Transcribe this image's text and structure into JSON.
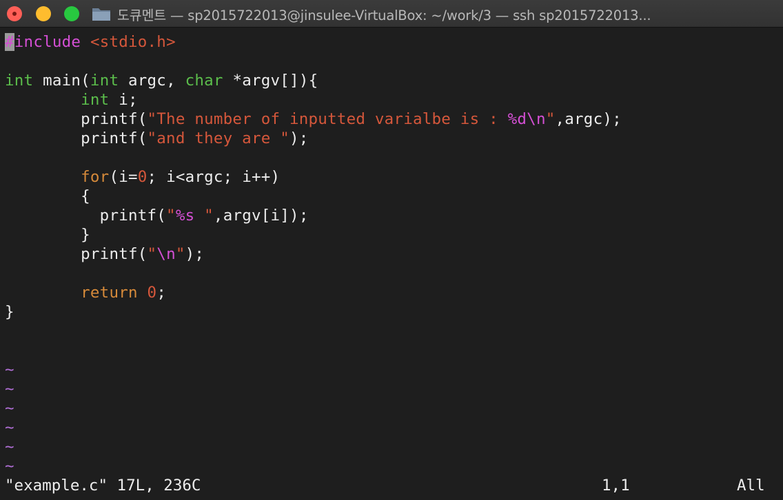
{
  "window": {
    "title": "도큐멘트 — sp2015722013@jinsulee-VirtualBox: ~/work/3 — ssh sp2015722013...",
    "traffic_lights": {
      "close": "#ff5f57",
      "minimize": "#febc2e",
      "maximize": "#28c840"
    },
    "icon": "folder-icon"
  },
  "editor": {
    "colors": {
      "background": "#1e1e1e",
      "foreground": "#ececec",
      "preprocessor": "#d44fd4",
      "string": "#d5573b",
      "type": "#5bbd4b",
      "keyword": "#d68a3a",
      "tilde": "#b16fd6"
    },
    "code": {
      "l1": {
        "hash": "#",
        "directive": "include",
        "header": "<stdio.h>"
      },
      "l3": {
        "t1": "int",
        "a": " main(",
        "t2": "int",
        "b": " argc, ",
        "t3": "char",
        "c": " *argv[]){"
      },
      "l4": {
        "t": "int",
        "a": " i;"
      },
      "l5": {
        "a": "printf(",
        "s": "\"The number of inputted varialbe is : ",
        "f": "%d\\n",
        "q": "\"",
        "b": ",argc);"
      },
      "l6": {
        "a": "printf(",
        "s": "\"and they are \"",
        "b": ");"
      },
      "l8": {
        "k": "for",
        "a": "(i=",
        "n": "0",
        "b": "; i<argc; i++)"
      },
      "l9": {
        "a": "{"
      },
      "l10": {
        "a": "printf(",
        "q1": "\"",
        "f": "%s",
        "q2": " \"",
        "b": ",argv[i]);"
      },
      "l11": {
        "a": "}"
      },
      "l12": {
        "a": "printf(",
        "q1": "\"",
        "f": "\\n",
        "q2": "\"",
        "b": ");"
      },
      "l14": {
        "k": "return",
        "sp": " ",
        "n": "0",
        "b": ";"
      },
      "l15": {
        "a": "}"
      }
    },
    "tilde": "~"
  },
  "status": {
    "file": "\"example.c\" 17L, 236C",
    "position": "1,1",
    "view": "All"
  }
}
